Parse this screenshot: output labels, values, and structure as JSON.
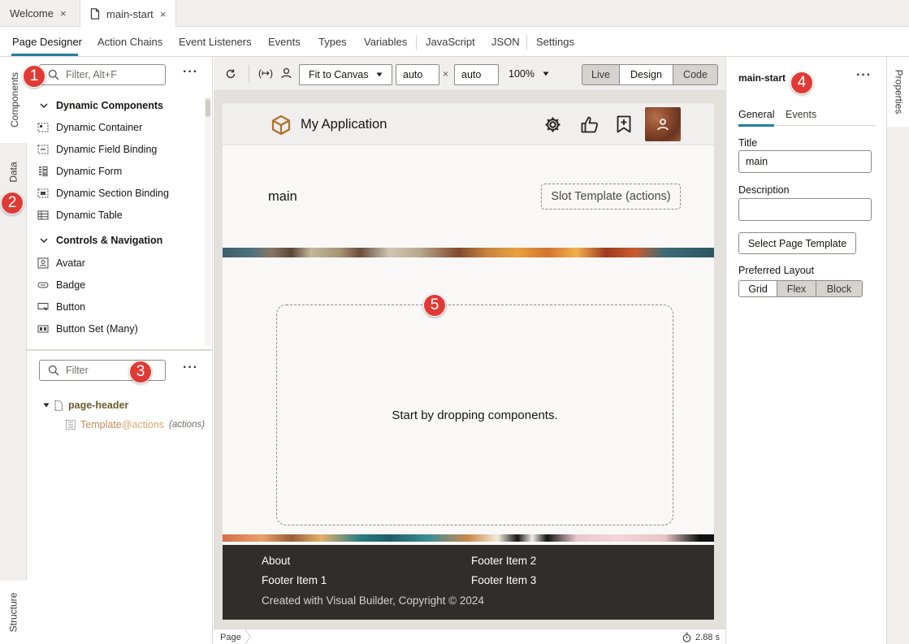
{
  "tabs": [
    {
      "label": "Welcome",
      "active": false
    },
    {
      "label": "main-start",
      "active": true
    }
  ],
  "subnav": [
    "Page Designer",
    "Action Chains",
    "Event Listeners",
    "Events",
    "Types",
    "Variables",
    "JavaScript",
    "JSON",
    "Settings"
  ],
  "vtabs": {
    "components": "Components",
    "data": "Data",
    "structure": "Structure"
  },
  "components_panel": {
    "search_placeholder": "Filter, Alt+F",
    "groups": [
      {
        "label": "Dynamic Components",
        "items": [
          {
            "label": "Dynamic Container",
            "icon": "dynamic-container-icon"
          },
          {
            "label": "Dynamic Field Binding",
            "icon": "dynamic-field-binding-icon"
          },
          {
            "label": "Dynamic Form",
            "icon": "dynamic-form-icon"
          },
          {
            "label": "Dynamic Section Binding",
            "icon": "dynamic-section-binding-icon"
          },
          {
            "label": "Dynamic Table",
            "icon": "dynamic-table-icon"
          }
        ]
      },
      {
        "label": "Controls & Navigation",
        "items": [
          {
            "label": "Avatar",
            "icon": "avatar-icon"
          },
          {
            "label": "Badge",
            "icon": "badge-icon"
          },
          {
            "label": "Button",
            "icon": "button-icon"
          },
          {
            "label": "Button Set (Many)",
            "icon": "button-set-icon"
          }
        ]
      }
    ]
  },
  "structure_panel": {
    "search_placeholder": "Filter",
    "tree": [
      {
        "label": "page-header"
      },
      {
        "label": "Template",
        "slot": "@actions",
        "note": "(actions)"
      }
    ]
  },
  "toolbar": {
    "fit": "Fit to Canvas",
    "width": "auto",
    "times": "×",
    "height": "auto",
    "zoom": "100%",
    "modes": [
      "Live",
      "Design",
      "Code"
    ],
    "active_mode": "Design"
  },
  "canvas": {
    "app_title": "My Application",
    "page_title": "main",
    "slot_template": "Slot Template (actions)",
    "drop_hint": "Start by dropping components.",
    "footer": {
      "items": [
        "About",
        "Footer Item 2",
        "Footer Item 1",
        "Footer Item 3"
      ],
      "copyright": "Created with Visual Builder, Copyright © 2024"
    }
  },
  "statusbar": {
    "breadcrumb": "Page",
    "timing": "2.88 s"
  },
  "properties": {
    "title": "main-start",
    "tabs": [
      "General",
      "Events"
    ],
    "title_label": "Title",
    "title_value": "main",
    "description_label": "Description",
    "description_value": "",
    "select_template": "Select Page Template",
    "layout_label": "Preferred Layout",
    "layouts": [
      "Grid",
      "Flex",
      "Block"
    ],
    "active_layout": "Grid",
    "strip_label": "Properties"
  },
  "markers": [
    "1",
    "2",
    "3",
    "4",
    "5"
  ],
  "colors": {
    "accent": "#227e9e",
    "marker": "#e03a35",
    "footer": "#312d2a",
    "header": "#f1efed"
  }
}
